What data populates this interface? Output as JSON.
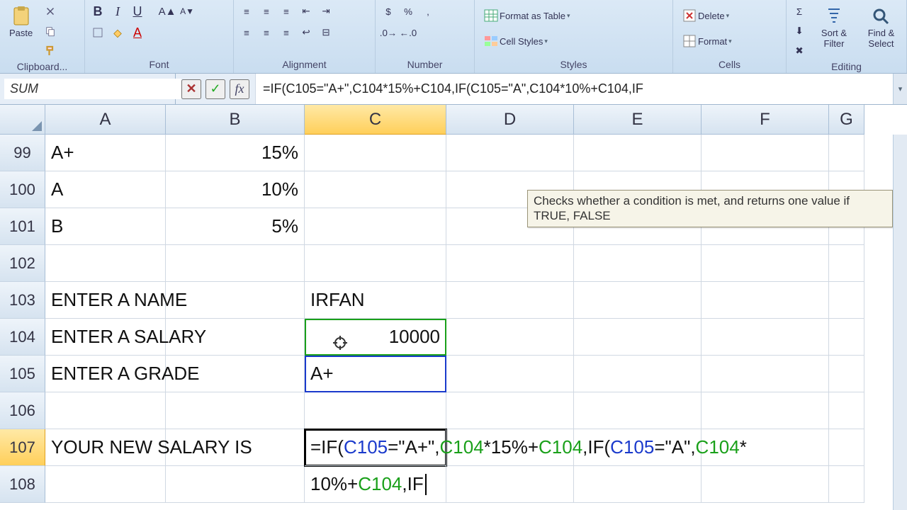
{
  "ribbon": {
    "clipboard": {
      "label": "Clipboard...",
      "paste": "Paste"
    },
    "font": {
      "label": "Font"
    },
    "alignment": {
      "label": "Alignment"
    },
    "number": {
      "label": "Number"
    },
    "styles": {
      "label": "Styles",
      "format_as_table": "Format as Table",
      "cell_styles": "Cell Styles"
    },
    "cells": {
      "label": "Cells",
      "delete": "Delete",
      "format": "Format"
    },
    "editing": {
      "label": "Editing",
      "sort_filter": "Sort & Filter",
      "find_select": "Find & Select"
    }
  },
  "formula_bar": {
    "name_box": "SUM",
    "formula": "=IF(C105=\"A+\",C104*15%+C104,IF(C105=\"A\",C104*10%+C104,IF"
  },
  "columns": [
    "A",
    "B",
    "C",
    "D",
    "E",
    "F",
    "G"
  ],
  "active_column_index": 2,
  "rows": [
    {
      "n": 99,
      "A": "A+",
      "B": "15%"
    },
    {
      "n": 100,
      "A": "A",
      "B": "10%"
    },
    {
      "n": 101,
      "A": "B",
      "B": "5%"
    },
    {
      "n": 102
    },
    {
      "n": 103,
      "A": "ENTER A NAME",
      "C": "IRFAN"
    },
    {
      "n": 104,
      "A": "ENTER A SALARY",
      "C": "10000"
    },
    {
      "n": 105,
      "A": "ENTER A GRADE",
      "C": "A+"
    },
    {
      "n": 106
    },
    {
      "n": 107,
      "A": "YOUR NEW SALARY IS"
    },
    {
      "n": 108
    }
  ],
  "active_row": 107,
  "editing_cell": {
    "row": 107,
    "col": "C",
    "tokens": [
      {
        "t": "=IF("
      },
      {
        "t": "C105",
        "c": "blue"
      },
      {
        "t": "=\"A+\","
      },
      {
        "t": "C104",
        "c": "green"
      },
      {
        "t": "*15%+"
      },
      {
        "t": "C104",
        "c": "green"
      },
      {
        "t": ",IF("
      },
      {
        "t": "C105",
        "c": "blue"
      },
      {
        "t": "=\"A\","
      },
      {
        "t": "C104",
        "c": "green"
      },
      {
        "t": "*"
      }
    ],
    "tokens_line2": [
      {
        "t": "10%+"
      },
      {
        "t": "C104",
        "c": "green"
      },
      {
        "t": ",IF"
      }
    ]
  },
  "tooltip": {
    "text": "Checks whether a condition is met, and returns one value if TRUE, FALSE"
  },
  "chart_data": {
    "type": "table",
    "grades": [
      {
        "grade": "A+",
        "raise_pct": 15
      },
      {
        "grade": "A",
        "raise_pct": 10
      },
      {
        "grade": "B",
        "raise_pct": 5
      }
    ],
    "input": {
      "name": "IRFAN",
      "salary": 10000,
      "grade": "A+"
    }
  }
}
